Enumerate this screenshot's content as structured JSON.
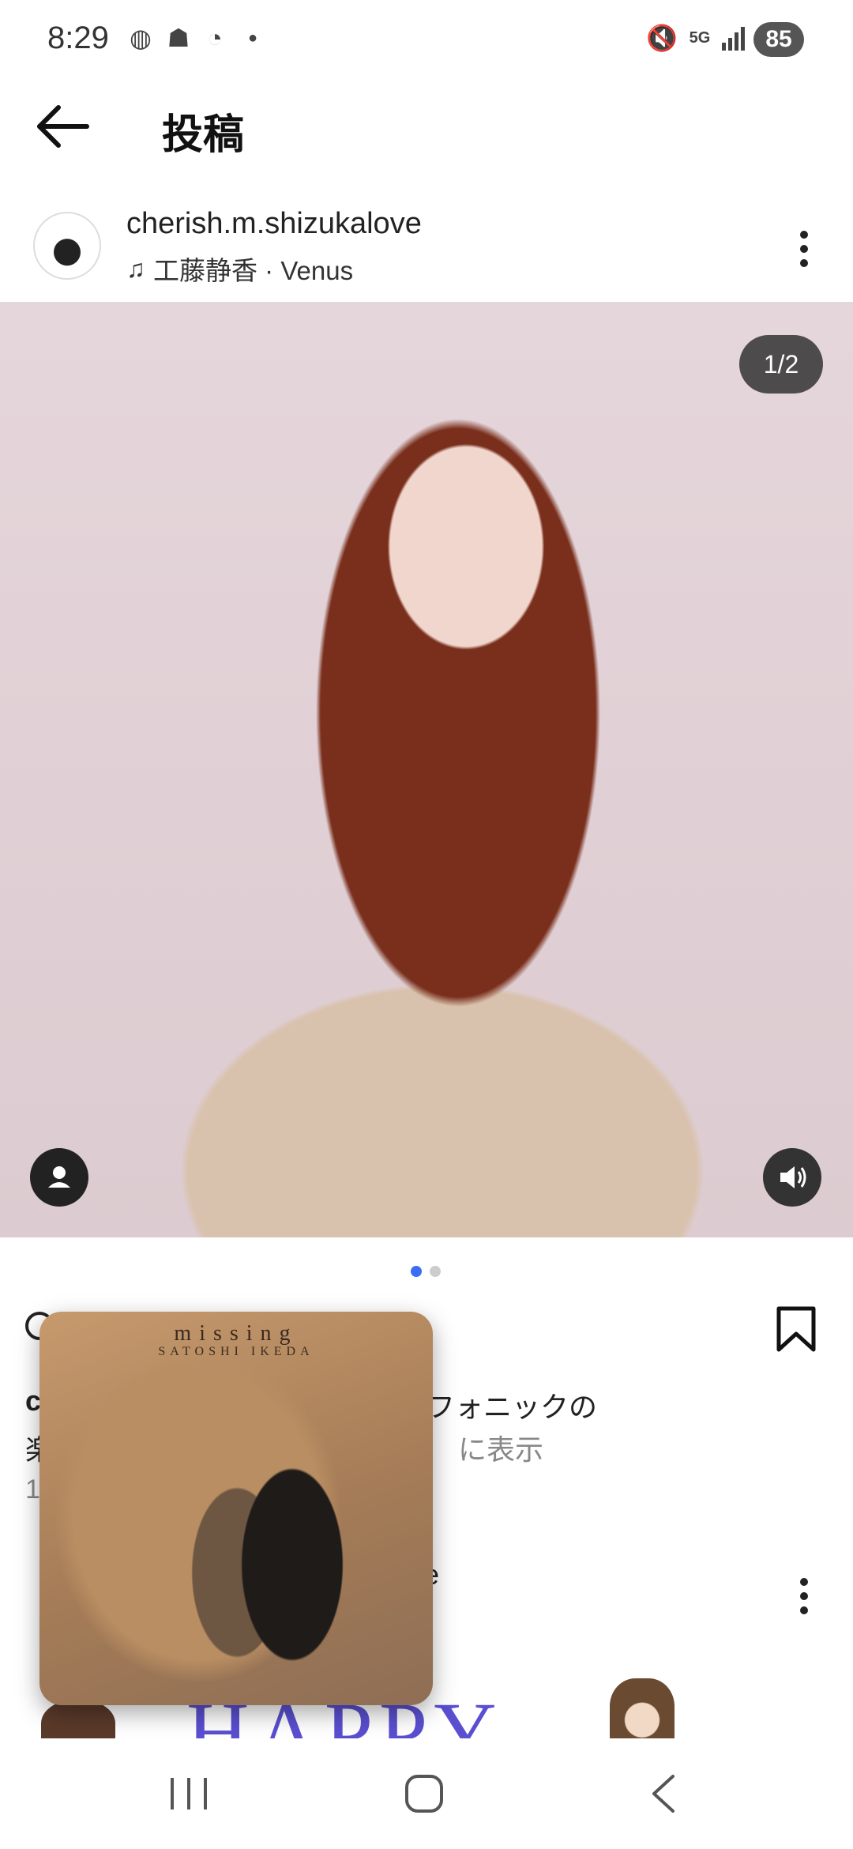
{
  "status_bar": {
    "time": "8:29",
    "battery": "85",
    "network": "5G"
  },
  "header": {
    "title": "投稿",
    "back_icon": "arrow-left-icon"
  },
  "post": {
    "author": "cherish.m.shizukalove",
    "music": "工藤静香 · Venus",
    "image_counter": "1/2",
    "caption_lead": "c",
    "caption_tail": "フォニックの",
    "caption_line2_lead": "楽",
    "caption_more": "に表示",
    "date_lead": "1"
  },
  "next_post": {
    "author_tail": "e",
    "image_text": "HAPPY"
  },
  "album_pip": {
    "title": "missing",
    "artist": "SATOSHI IKEDA"
  },
  "colors": {
    "accent_dot": "#3b6ef5",
    "photo_bg": "#e5d6db"
  }
}
